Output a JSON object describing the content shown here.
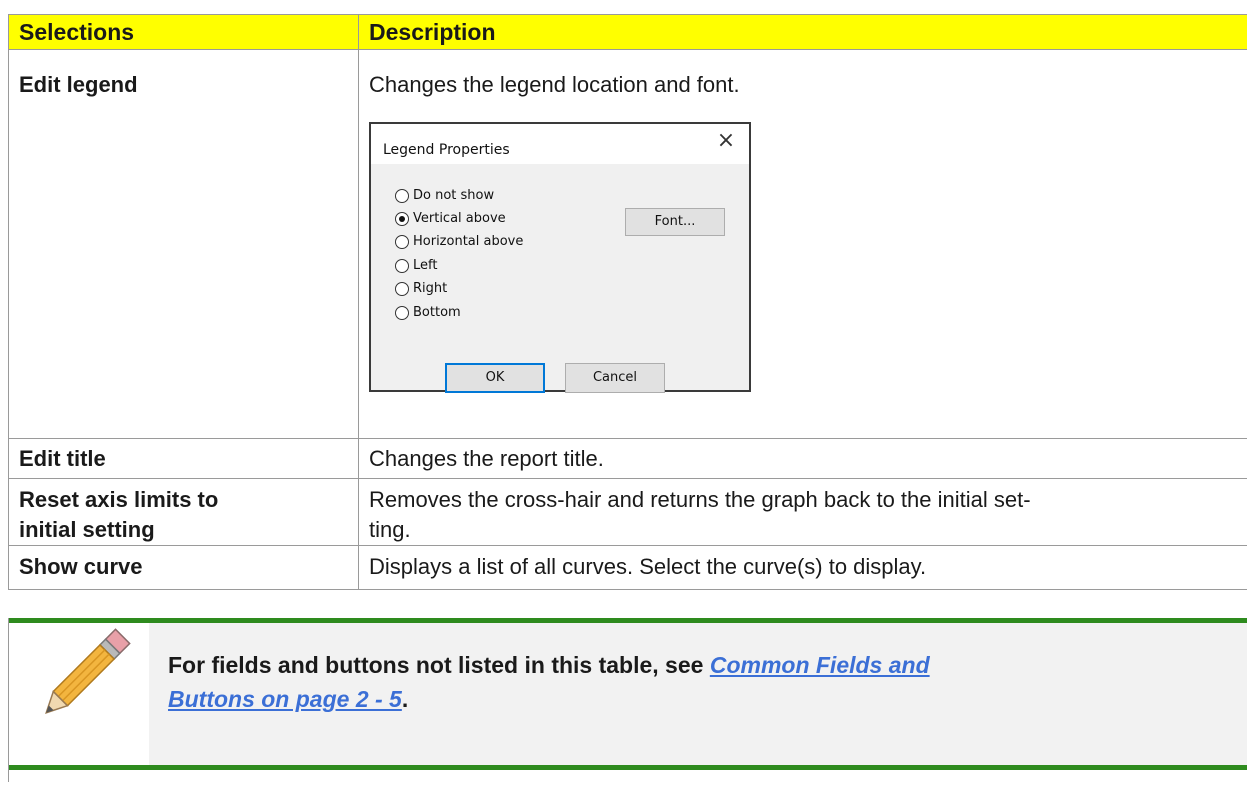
{
  "table": {
    "headers": {
      "selections": "Selections",
      "description": "Description"
    },
    "rows": [
      {
        "name": "Edit legend",
        "description": "Changes the legend location and font."
      },
      {
        "name": "Edit title",
        "description": "Changes the report title."
      },
      {
        "name_line1": "Reset axis limits to",
        "name_line2": "initial setting",
        "description_line1": "Removes the cross-hair and returns the graph back to the initial set-",
        "description_line2": "ting."
      },
      {
        "name": "Show curve",
        "description": "Displays a list of all curves. Select the curve(s) to display."
      }
    ],
    "header_color": "#ffff00"
  },
  "dialog": {
    "title": "Legend Properties",
    "close_glyph": "×",
    "options": [
      {
        "label": "Do not show",
        "checked": false
      },
      {
        "label": "Vertical above",
        "checked": true
      },
      {
        "label": "Horizontal above",
        "checked": false
      },
      {
        "label": "Left",
        "checked": false
      },
      {
        "label": "Right",
        "checked": false
      },
      {
        "label": "Bottom",
        "checked": false
      }
    ],
    "font_button": "Font...",
    "ok_button": "OK",
    "cancel_button": "Cancel"
  },
  "note": {
    "icon": "pencil-icon",
    "text_prefix": "For fields and buttons not listed in this table, see ",
    "link_line1": "Common Fields and ",
    "link_line2": "Buttons on page 2 - 5",
    "text_suffix": ".",
    "bar_color": "#2e8b1e",
    "link_color": "#3b6fd6"
  }
}
